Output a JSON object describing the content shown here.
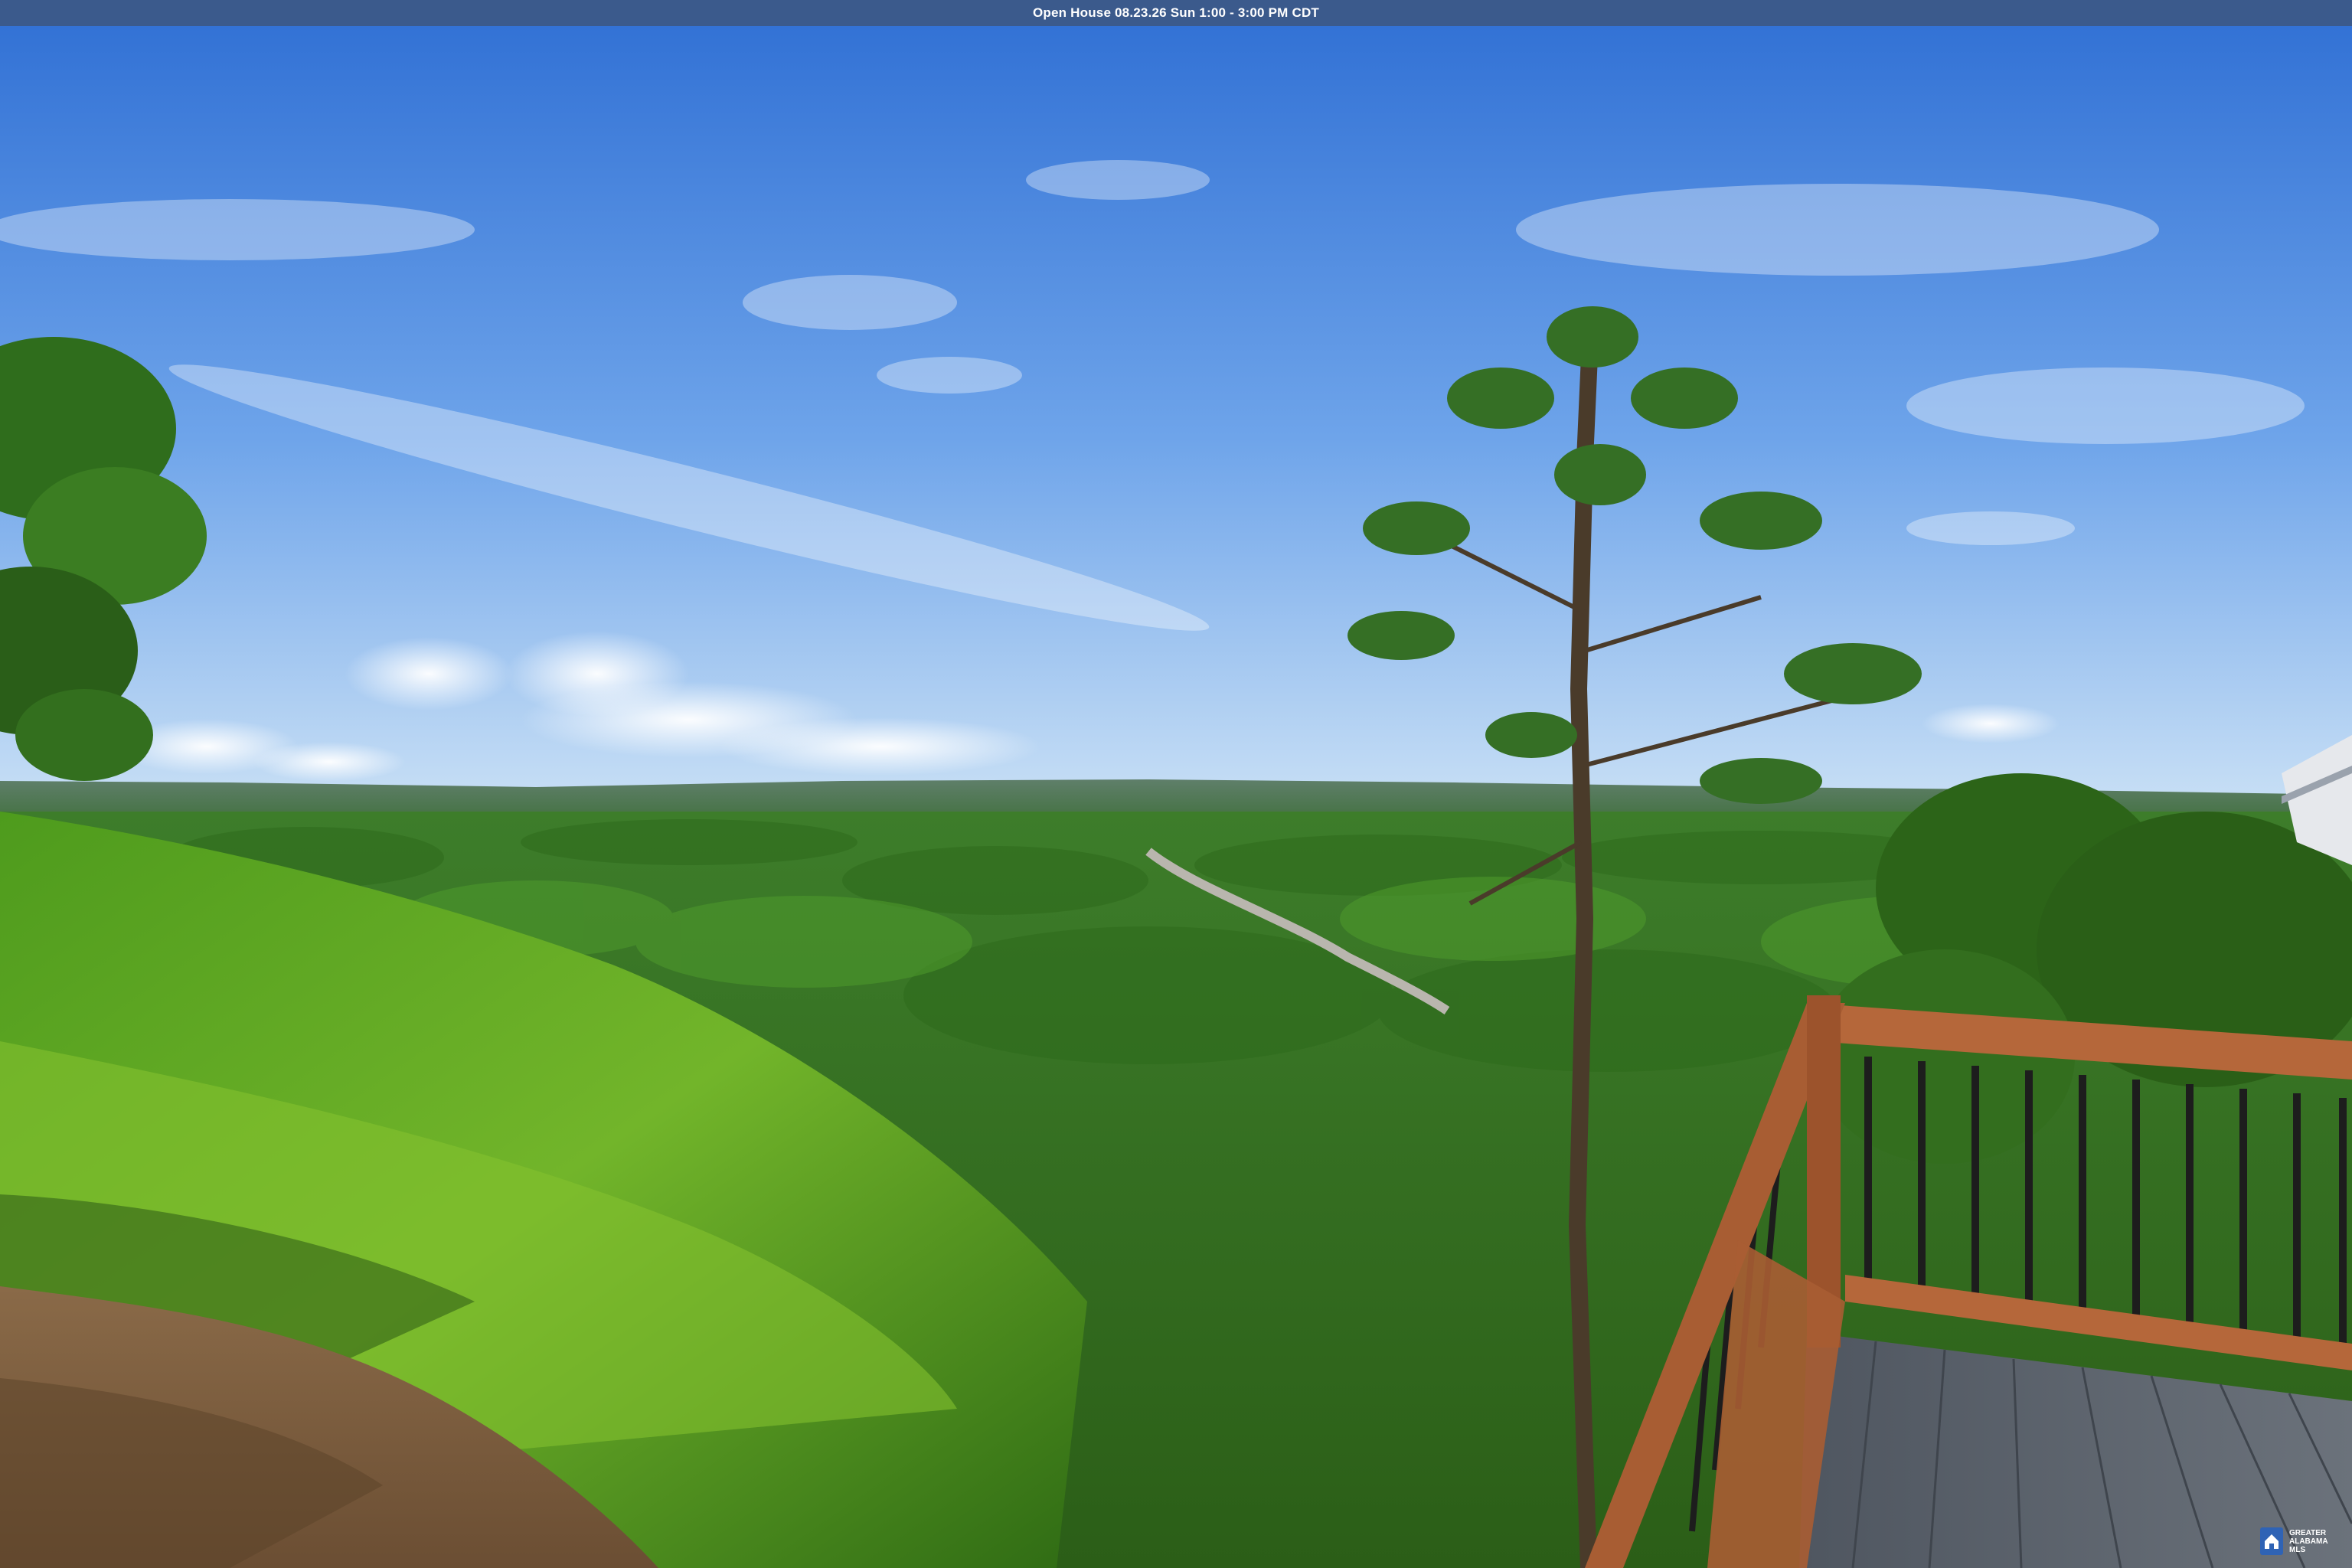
{
  "banner": {
    "text": "Open House 08.23.26 Sun 1:00 - 3:00 PM CDT"
  },
  "watermark": {
    "line1": "GREATER",
    "line2": "ALABAMA",
    "line3": "MLS",
    "icon": "house-logo-icon"
  },
  "scene": {
    "description_icon": "landscape-photo",
    "colors": {
      "sky_top": "#3a78d8",
      "sky_horizon": "#bcd8f3",
      "forest": "#3f8a1f",
      "deck_rail": "#b5673a",
      "deck_floor": "#5f6670"
    }
  }
}
